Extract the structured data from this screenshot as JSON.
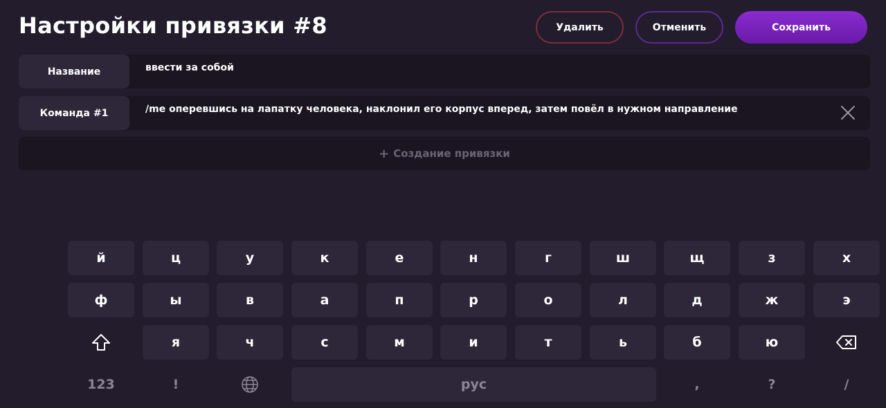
{
  "header": {
    "title": "Настройки привязки #8",
    "delete_label": "Удалить",
    "cancel_label": "Отменить",
    "save_label": "Сохранить"
  },
  "fields": {
    "name": {
      "label": "Название",
      "value": "ввести за собой"
    },
    "command1": {
      "label": "Команда #1",
      "value": "/me оперевшись на лапатку человека, наклонил его корпус вперед, затем повёл в нужном направление"
    }
  },
  "add_binding": {
    "icon": "plus-icon",
    "label": "Создание привязки"
  },
  "keyboard": {
    "row1": [
      "й",
      "ц",
      "у",
      "к",
      "е",
      "н",
      "г",
      "ш",
      "щ",
      "з",
      "х"
    ],
    "row2": [
      "ф",
      "ы",
      "в",
      "а",
      "п",
      "р",
      "о",
      "л",
      "д",
      "ж",
      "э"
    ],
    "row3": [
      "я",
      "ч",
      "с",
      "м",
      "и",
      "т",
      "ь",
      "б",
      "ю"
    ],
    "row4": {
      "numbers": "123",
      "exclamation": "!",
      "space": "рус",
      "comma": ",",
      "question": "?",
      "slash": "/"
    },
    "icons": {
      "shift": "shift-icon",
      "backspace": "backspace-icon",
      "language": "globe-icon"
    }
  },
  "colors": {
    "background": "#221c2c",
    "key": "#2e2639",
    "delete_border": "#7a2e3c",
    "cancel_border": "#5a2c8c",
    "save_fill": "#7b22bc"
  }
}
